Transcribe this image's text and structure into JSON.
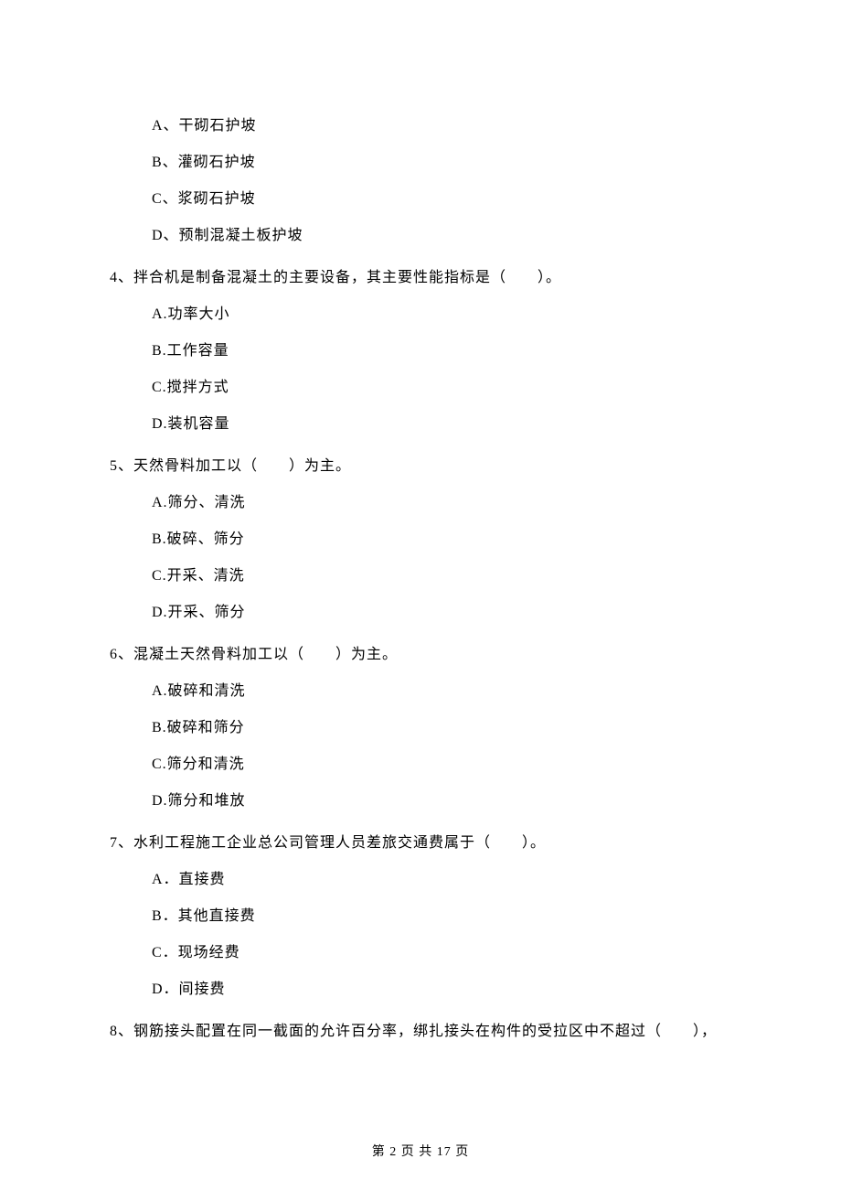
{
  "blocks": [
    {
      "type": "option",
      "text": "A、干砌石护坡"
    },
    {
      "type": "option",
      "text": "B、灌砌石护坡"
    },
    {
      "type": "option",
      "text": "C、浆砌石护坡"
    },
    {
      "type": "option",
      "text": "D、预制混凝土板护坡"
    },
    {
      "type": "question",
      "text": "4、拌合机是制备混凝土的主要设备，其主要性能指标是（　　）。"
    },
    {
      "type": "option",
      "text": "A.功率大小"
    },
    {
      "type": "option",
      "text": "B.工作容量"
    },
    {
      "type": "option",
      "text": "C.搅拌方式"
    },
    {
      "type": "option",
      "text": "D.装机容量"
    },
    {
      "type": "question",
      "text": "5、天然骨料加工以（　　）为主。"
    },
    {
      "type": "option",
      "text": "A.筛分、清洗"
    },
    {
      "type": "option",
      "text": "B.破碎、筛分"
    },
    {
      "type": "option",
      "text": "C.开采、清洗"
    },
    {
      "type": "option",
      "text": "D.开采、筛分"
    },
    {
      "type": "question",
      "text": "6、混凝土天然骨料加工以（　　）为主。"
    },
    {
      "type": "option",
      "text": "A.破碎和清洗"
    },
    {
      "type": "option",
      "text": "B.破碎和筛分"
    },
    {
      "type": "option",
      "text": "C.筛分和清洗"
    },
    {
      "type": "option",
      "text": "D.筛分和堆放"
    },
    {
      "type": "question",
      "text": "7、水利工程施工企业总公司管理人员差旅交通费属于（　　）。"
    },
    {
      "type": "option",
      "text": "A．直接费"
    },
    {
      "type": "option",
      "text": "B．其他直接费"
    },
    {
      "type": "option",
      "text": "C．现场经费"
    },
    {
      "type": "option",
      "text": "D．间接费"
    },
    {
      "type": "question",
      "text": "8、钢筋接头配置在同一截面的允许百分率，绑扎接头在构件的受拉区中不超过（　　），"
    }
  ],
  "footer": "第 2 页 共 17 页"
}
